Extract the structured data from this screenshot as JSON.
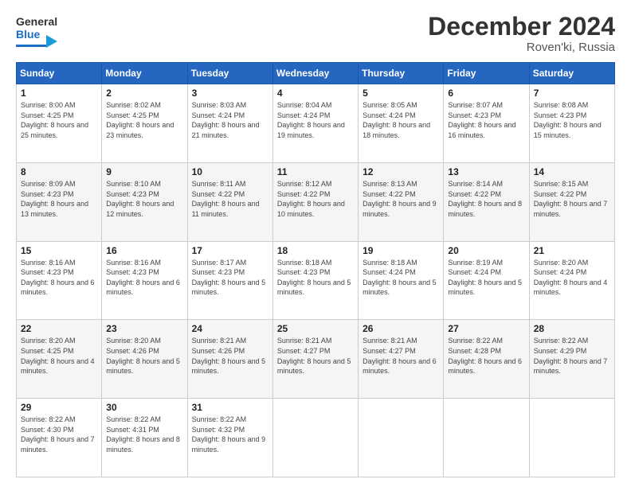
{
  "header": {
    "logo": {
      "general": "General",
      "blue": "Blue"
    },
    "title": "December 2024",
    "location": "Roven'ki, Russia"
  },
  "days_of_week": [
    "Sunday",
    "Monday",
    "Tuesday",
    "Wednesday",
    "Thursday",
    "Friday",
    "Saturday"
  ],
  "weeks": [
    [
      {
        "day": "1",
        "sunrise": "Sunrise: 8:00 AM",
        "sunset": "Sunset: 4:25 PM",
        "daylight": "Daylight: 8 hours and 25 minutes."
      },
      {
        "day": "2",
        "sunrise": "Sunrise: 8:02 AM",
        "sunset": "Sunset: 4:25 PM",
        "daylight": "Daylight: 8 hours and 23 minutes."
      },
      {
        "day": "3",
        "sunrise": "Sunrise: 8:03 AM",
        "sunset": "Sunset: 4:24 PM",
        "daylight": "Daylight: 8 hours and 21 minutes."
      },
      {
        "day": "4",
        "sunrise": "Sunrise: 8:04 AM",
        "sunset": "Sunset: 4:24 PM",
        "daylight": "Daylight: 8 hours and 19 minutes."
      },
      {
        "day": "5",
        "sunrise": "Sunrise: 8:05 AM",
        "sunset": "Sunset: 4:24 PM",
        "daylight": "Daylight: 8 hours and 18 minutes."
      },
      {
        "day": "6",
        "sunrise": "Sunrise: 8:07 AM",
        "sunset": "Sunset: 4:23 PM",
        "daylight": "Daylight: 8 hours and 16 minutes."
      },
      {
        "day": "7",
        "sunrise": "Sunrise: 8:08 AM",
        "sunset": "Sunset: 4:23 PM",
        "daylight": "Daylight: 8 hours and 15 minutes."
      }
    ],
    [
      {
        "day": "8",
        "sunrise": "Sunrise: 8:09 AM",
        "sunset": "Sunset: 4:23 PM",
        "daylight": "Daylight: 8 hours and 13 minutes."
      },
      {
        "day": "9",
        "sunrise": "Sunrise: 8:10 AM",
        "sunset": "Sunset: 4:23 PM",
        "daylight": "Daylight: 8 hours and 12 minutes."
      },
      {
        "day": "10",
        "sunrise": "Sunrise: 8:11 AM",
        "sunset": "Sunset: 4:22 PM",
        "daylight": "Daylight: 8 hours and 11 minutes."
      },
      {
        "day": "11",
        "sunrise": "Sunrise: 8:12 AM",
        "sunset": "Sunset: 4:22 PM",
        "daylight": "Daylight: 8 hours and 10 minutes."
      },
      {
        "day": "12",
        "sunrise": "Sunrise: 8:13 AM",
        "sunset": "Sunset: 4:22 PM",
        "daylight": "Daylight: 8 hours and 9 minutes."
      },
      {
        "day": "13",
        "sunrise": "Sunrise: 8:14 AM",
        "sunset": "Sunset: 4:22 PM",
        "daylight": "Daylight: 8 hours and 8 minutes."
      },
      {
        "day": "14",
        "sunrise": "Sunrise: 8:15 AM",
        "sunset": "Sunset: 4:22 PM",
        "daylight": "Daylight: 8 hours and 7 minutes."
      }
    ],
    [
      {
        "day": "15",
        "sunrise": "Sunrise: 8:16 AM",
        "sunset": "Sunset: 4:23 PM",
        "daylight": "Daylight: 8 hours and 6 minutes."
      },
      {
        "day": "16",
        "sunrise": "Sunrise: 8:16 AM",
        "sunset": "Sunset: 4:23 PM",
        "daylight": "Daylight: 8 hours and 6 minutes."
      },
      {
        "day": "17",
        "sunrise": "Sunrise: 8:17 AM",
        "sunset": "Sunset: 4:23 PM",
        "daylight": "Daylight: 8 hours and 5 minutes."
      },
      {
        "day": "18",
        "sunrise": "Sunrise: 8:18 AM",
        "sunset": "Sunset: 4:23 PM",
        "daylight": "Daylight: 8 hours and 5 minutes."
      },
      {
        "day": "19",
        "sunrise": "Sunrise: 8:18 AM",
        "sunset": "Sunset: 4:24 PM",
        "daylight": "Daylight: 8 hours and 5 minutes."
      },
      {
        "day": "20",
        "sunrise": "Sunrise: 8:19 AM",
        "sunset": "Sunset: 4:24 PM",
        "daylight": "Daylight: 8 hours and 5 minutes."
      },
      {
        "day": "21",
        "sunrise": "Sunrise: 8:20 AM",
        "sunset": "Sunset: 4:24 PM",
        "daylight": "Daylight: 8 hours and 4 minutes."
      }
    ],
    [
      {
        "day": "22",
        "sunrise": "Sunrise: 8:20 AM",
        "sunset": "Sunset: 4:25 PM",
        "daylight": "Daylight: 8 hours and 4 minutes."
      },
      {
        "day": "23",
        "sunrise": "Sunrise: 8:20 AM",
        "sunset": "Sunset: 4:26 PM",
        "daylight": "Daylight: 8 hours and 5 minutes."
      },
      {
        "day": "24",
        "sunrise": "Sunrise: 8:21 AM",
        "sunset": "Sunset: 4:26 PM",
        "daylight": "Daylight: 8 hours and 5 minutes."
      },
      {
        "day": "25",
        "sunrise": "Sunrise: 8:21 AM",
        "sunset": "Sunset: 4:27 PM",
        "daylight": "Daylight: 8 hours and 5 minutes."
      },
      {
        "day": "26",
        "sunrise": "Sunrise: 8:21 AM",
        "sunset": "Sunset: 4:27 PM",
        "daylight": "Daylight: 8 hours and 6 minutes."
      },
      {
        "day": "27",
        "sunrise": "Sunrise: 8:22 AM",
        "sunset": "Sunset: 4:28 PM",
        "daylight": "Daylight: 8 hours and 6 minutes."
      },
      {
        "day": "28",
        "sunrise": "Sunrise: 8:22 AM",
        "sunset": "Sunset: 4:29 PM",
        "daylight": "Daylight: 8 hours and 7 minutes."
      }
    ],
    [
      {
        "day": "29",
        "sunrise": "Sunrise: 8:22 AM",
        "sunset": "Sunset: 4:30 PM",
        "daylight": "Daylight: 8 hours and 7 minutes."
      },
      {
        "day": "30",
        "sunrise": "Sunrise: 8:22 AM",
        "sunset": "Sunset: 4:31 PM",
        "daylight": "Daylight: 8 hours and 8 minutes."
      },
      {
        "day": "31",
        "sunrise": "Sunrise: 8:22 AM",
        "sunset": "Sunset: 4:32 PM",
        "daylight": "Daylight: 8 hours and 9 minutes."
      },
      null,
      null,
      null,
      null
    ]
  ]
}
